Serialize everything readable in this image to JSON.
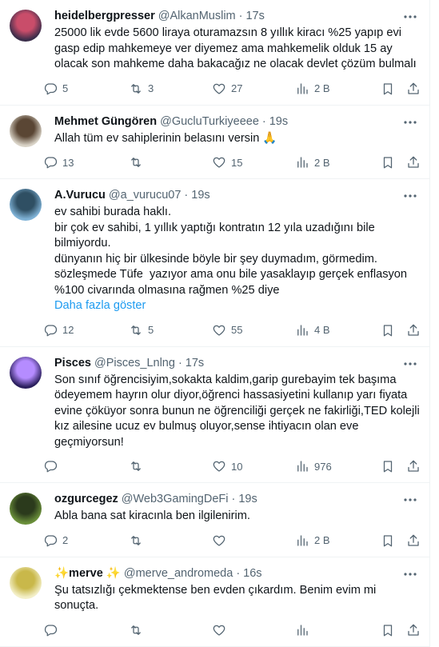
{
  "tweets": [
    {
      "name": "heidelbergpresser",
      "handle": "@AlkanMuslim",
      "time": "17s",
      "text": "25000 lik evde 5600 liraya oturamazsın 8 yıllık kiracı %25 yapıp evi gasp edip mahkemeye ver diyemez ama mahkemelik olduk 15 ay olacak son mahkeme daha bakacağız ne olacak devlet çözüm bulmalı",
      "show_more": "",
      "replies": "5",
      "retweets": "3",
      "likes": "27",
      "views": "2 B",
      "avatar_colors": [
        "#3b2d4a",
        "#c94d6a"
      ]
    },
    {
      "name": "Mehmet Güngören",
      "handle": "@GucluTurkiyeeee",
      "time": "19s",
      "text": "Allah tüm ev sahiplerinin belasını versin 🙏",
      "show_more": "",
      "replies": "13",
      "retweets": "",
      "likes": "15",
      "views": "2 B",
      "avatar_colors": [
        "#d9d3c7",
        "#5a4634"
      ]
    },
    {
      "name": "A.Vurucu",
      "handle": "@a_vurucu07",
      "time": "19s",
      "text": "ev sahibi burada haklı.\nbir çok ev sahibi, 1 yıllık yaptığı kontratın 12 yıla uzadığını bile bilmiyordu.\ndünyanın hiç bir ülkesinde böyle bir şey duymadım, görmedim. sözleşmede Tüfe  yazıyor ama onu bile yasaklayıp gerçek enflasyon %100 civarında olmasına rağmen %25 diye",
      "show_more": "Daha fazla göster",
      "replies": "12",
      "retweets": "5",
      "likes": "55",
      "views": "4 B",
      "avatar_colors": [
        "#7fb2d6",
        "#2f4f63"
      ]
    },
    {
      "name": "Pisces",
      "handle": "@Pisces_Lnlng",
      "time": "17s",
      "text": "Son sınıf öğrencisiyim,sokakta kaldim,garip gurebayim tek başıma ödeyemem hayrın olur diyor,öğrenci hassasiyetini kullanıp yarı fiyata evine çöküyor sonra bunun ne öğrenciliği gerçek ne fakirliği,TED kolejli kız ailesine ucuz ev bulmuş oluyor,sense ihtiyacın olan eve geçmiyorsun!",
      "show_more": "",
      "replies": "",
      "retweets": "",
      "likes": "10",
      "views": "976",
      "avatar_colors": [
        "#2a1f5c",
        "#b58cff"
      ]
    },
    {
      "name": "ozgurcegez",
      "handle": "@Web3GamingDeFi",
      "time": "19s",
      "text": "Abla bana sat kiracınla ben ilgilenirim.",
      "show_more": "",
      "replies": "2",
      "retweets": "",
      "likes": "",
      "views": "2 B",
      "avatar_colors": [
        "#6a8f3a",
        "#2b3a1c"
      ]
    },
    {
      "name": "✨merve ✨",
      "handle": "@merve_andromeda",
      "time": "16s",
      "text": "Şu tatsızlığı çekmektense ben evden çıkardım. Benim evim mi sonuçta.",
      "show_more": "",
      "replies": "",
      "retweets": "",
      "likes": "",
      "views": "",
      "avatar_colors": [
        "#f3efc8",
        "#c9b84a"
      ]
    }
  ],
  "icons": {
    "reply": "reply-icon",
    "retweet": "retweet-icon",
    "like": "heart-icon",
    "views": "views-chart-icon",
    "bookmark": "bookmark-icon",
    "share": "share-icon",
    "more": "more-icon"
  },
  "colors": {
    "text": "#0f1419",
    "secondary": "#536471",
    "link": "#1d9bf0",
    "divider": "#eff3f4"
  }
}
